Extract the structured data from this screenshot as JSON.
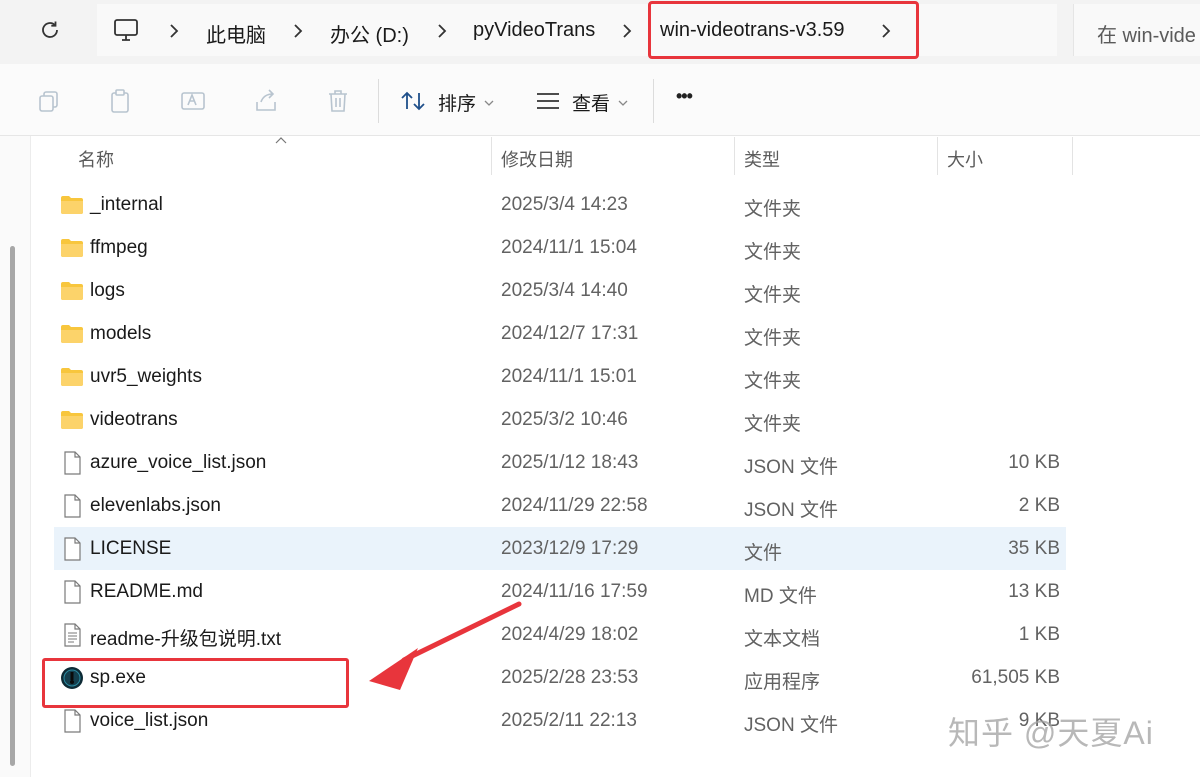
{
  "address": {
    "crumbs": [
      "此电脑",
      "办公 (D:)",
      "pyVideoTrans",
      "win-videotrans-v3.59"
    ],
    "search_placeholder": "在 win-vide"
  },
  "toolbar": {
    "sort_label": "排序",
    "view_label": "查看",
    "more_label": "•••"
  },
  "columns": {
    "name": "名称",
    "modified": "修改日期",
    "type": "类型",
    "size": "大小"
  },
  "files": [
    {
      "name": "_internal",
      "date": "2025/3/4 14:23",
      "type": "文件夹",
      "size": "",
      "icon": "folder-icon"
    },
    {
      "name": "ffmpeg",
      "date": "2024/11/1 15:04",
      "type": "文件夹",
      "size": "",
      "icon": "folder-icon"
    },
    {
      "name": "logs",
      "date": "2025/3/4 14:40",
      "type": "文件夹",
      "size": "",
      "icon": "folder-icon"
    },
    {
      "name": "models",
      "date": "2024/12/7 17:31",
      "type": "文件夹",
      "size": "",
      "icon": "folder-icon"
    },
    {
      "name": "uvr5_weights",
      "date": "2024/11/1 15:01",
      "type": "文件夹",
      "size": "",
      "icon": "folder-icon"
    },
    {
      "name": "videotrans",
      "date": "2025/3/2 10:46",
      "type": "文件夹",
      "size": "",
      "icon": "folder-icon"
    },
    {
      "name": "azure_voice_list.json",
      "date": "2025/1/12 18:43",
      "type": "JSON 文件",
      "size": "10 KB",
      "icon": "file-icon"
    },
    {
      "name": "elevenlabs.json",
      "date": "2024/11/29 22:58",
      "type": "JSON 文件",
      "size": "2 KB",
      "icon": "file-icon"
    },
    {
      "name": "LICENSE",
      "date": "2023/12/9 17:29",
      "type": "文件",
      "size": "35 KB",
      "icon": "file-icon"
    },
    {
      "name": "README.md",
      "date": "2024/11/16 17:59",
      "type": "MD 文件",
      "size": "13 KB",
      "icon": "file-icon"
    },
    {
      "name": "readme-升级包说明.txt",
      "date": "2024/4/29 18:02",
      "type": "文本文档",
      "size": "1 KB",
      "icon": "text-file-icon"
    },
    {
      "name": "sp.exe",
      "date": "2025/2/28 23:53",
      "type": "应用程序",
      "size": "61,505 KB",
      "icon": "app-icon"
    },
    {
      "name": "voice_list.json",
      "date": "2025/2/11 22:13",
      "type": "JSON 文件",
      "size": "9 KB",
      "icon": "file-icon"
    }
  ],
  "watermark": "知乎 @天夏Ai",
  "colors": {
    "highlight_red": "#e8353c",
    "selected_row": "#eaf3fb",
    "folder_yellow": "#f8c63d"
  }
}
